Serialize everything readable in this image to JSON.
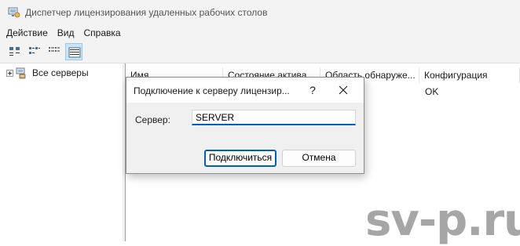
{
  "window": {
    "title": "Диспетчер лицензирования удаленных рабочих столов",
    "icon": "license-manager-icon"
  },
  "menubar": {
    "items": [
      "Действие",
      "Вид",
      "Справка"
    ]
  },
  "toolbar": {
    "buttons": [
      {
        "icon": "large-icons-view-icon"
      },
      {
        "icon": "small-icons-view-icon"
      },
      {
        "icon": "list-view-icon"
      },
      {
        "icon": "details-view-icon",
        "active": true
      }
    ]
  },
  "tree": {
    "root_label": "Все серверы",
    "root_icon": "servers-icon"
  },
  "table": {
    "columns": [
      "Имя",
      "Состояние актива...",
      "Область обнаруже...",
      "Конфигурация"
    ],
    "rows": [
      [
        "",
        "",
        "",
        "OK"
      ]
    ]
  },
  "dialog": {
    "title": "Подключение к серверу лицензир...",
    "help_label": "?",
    "server_label": "Сервер:",
    "server_value": "SERVER",
    "connect_label": "Подключиться",
    "cancel_label": "Отмена"
  },
  "watermark": "sv-p.ru",
  "colors": {
    "accent": "#005fb8",
    "chrome_bg": "#f3f3f3",
    "dialog_bg": "#f0f0f0",
    "selected_button_bg": "#cce4f7"
  }
}
